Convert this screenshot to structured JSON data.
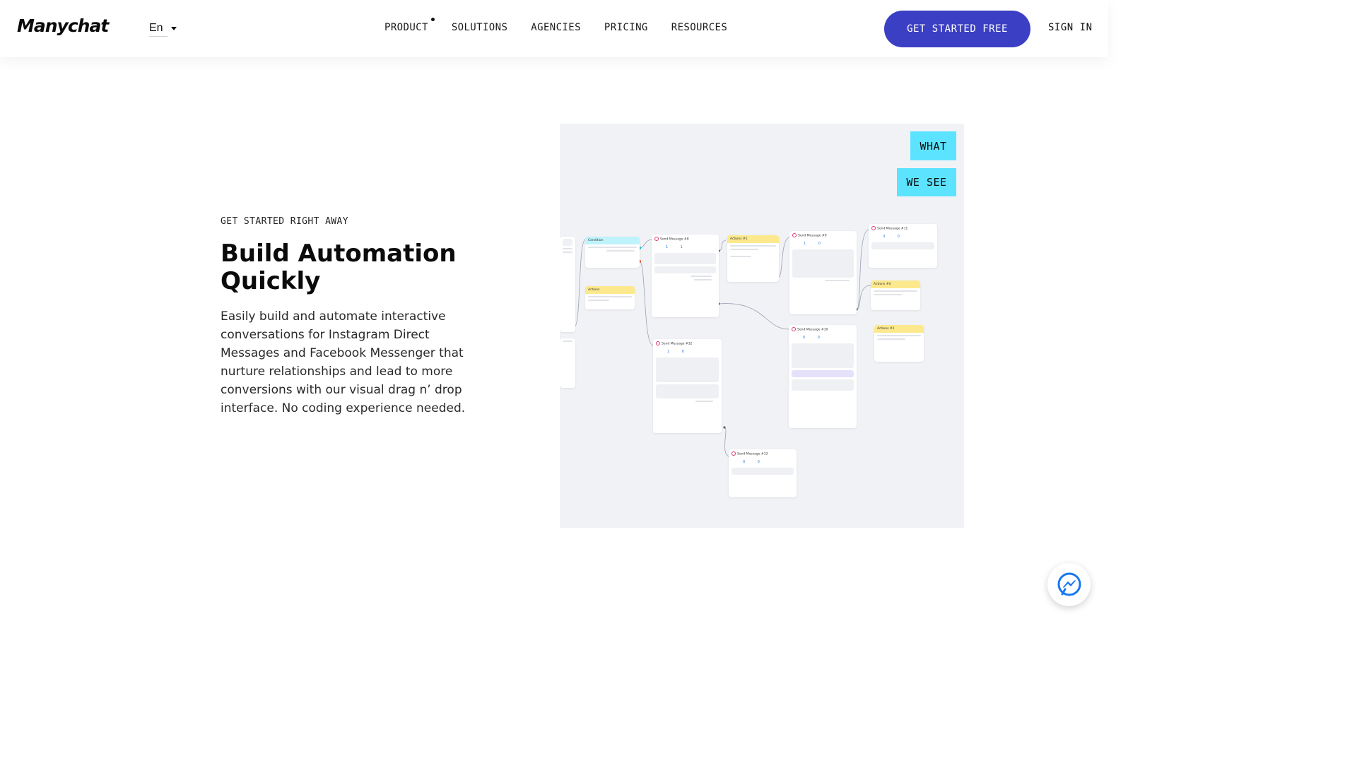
{
  "header": {
    "logo_text": "Manychat",
    "language": "En",
    "nav": [
      "PRODUCT",
      "SOLUTIONS",
      "AGENCIES",
      "PRICING",
      "RESOURCES"
    ],
    "cta_label": "GET STARTED FREE",
    "signin_label": "SIGN IN"
  },
  "hero": {
    "eyebrow": "GET STARTED RIGHT AWAY",
    "headline_line1": "Build Automation",
    "headline_line2": "Quickly",
    "body": "Easily build and automate interactive conversations for Instagram Direct Messages and Facebook Messenger that nurture relationships and lead to more conversions with our visual drag n’ drop interface. No coding experience needed."
  },
  "flow": {
    "tag_what": "WHAT",
    "tag_wesee": "WE SEE",
    "cards": [
      {
        "title": "Condition"
      },
      {
        "title": "Send Message #8"
      },
      {
        "title": "Actions #1"
      },
      {
        "title": "Send Message #9"
      },
      {
        "title": "Send Message #11"
      },
      {
        "title": "Actions"
      },
      {
        "title": "Actions #4"
      },
      {
        "title": "Send Message #12"
      },
      {
        "title": "Send Message #10"
      },
      {
        "title": "Actions #2"
      },
      {
        "title": "Send Message #13"
      }
    ]
  },
  "colors": {
    "cta": "#3b3fc4",
    "tag": "#5ce3ff",
    "panel": "#f1f2f6",
    "messenger_blue": "#1877f2"
  },
  "icons": {
    "chat": "messenger-icon",
    "language_caret": "caret-down-icon"
  }
}
